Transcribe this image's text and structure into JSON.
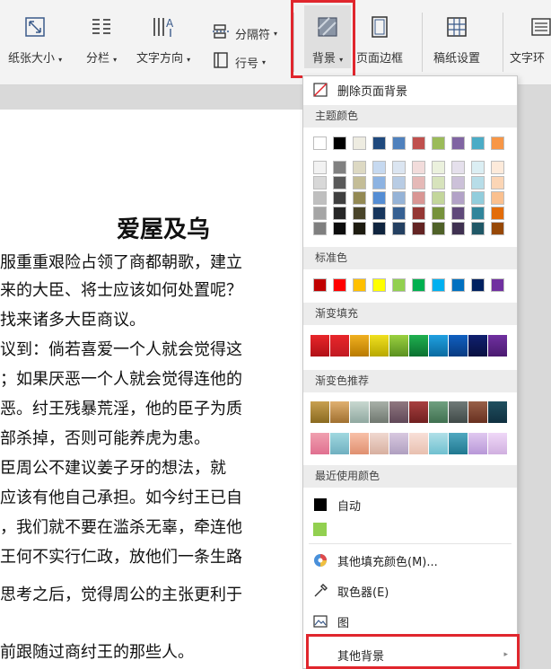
{
  "toolbar": {
    "paper_size": "纸张大小",
    "columns": "分栏",
    "text_direction": "文字方向",
    "breaks": "分隔符",
    "line_numbers": "行号",
    "background": "背景",
    "page_border": "页面边框",
    "manuscript": "稿纸设置",
    "text_wrap": "文字环"
  },
  "document": {
    "title": "爱屋及乌",
    "lines": [
      "服重重艰险占领了商都朝歌，建立",
      "来的大臣、将士应该如何处置呢？",
      "找来诸多大臣商议。",
      "议到：倘若喜爱一个人就会觉得这",
      "；如果厌恶一个人就会觉得连他的",
      "恶。纣王残暴荒淫，他的臣子为质",
      "部杀掉，否则可能养虎为患。",
      "臣周公不建议姜子牙的想法，就",
      "应该有他自己承担。如今纣王已自",
      "，我们就不要在滥杀无辜，牵连他",
      "王何不实行仁政，放他们一条生路",
      "",
      "思考之后，觉得周公的主张更利于",
      "前跟随过商纣王的那些人。"
    ]
  },
  "menu": {
    "remove_bg": "删除页面背景",
    "theme_colors": "主题颜色",
    "standard_colors": "标准色",
    "gradient_fill": "渐变填充",
    "gradient_recommend": "渐变色推荐",
    "recent_colors": "最近使用颜色",
    "auto": "自动",
    "more_fill": "其他填充颜色(M)...",
    "eyedropper": "取色器(E)",
    "picture": "图",
    "other_bg": "其他背景",
    "theme_top": [
      "#ffffff",
      "#000000",
      "#eeece1",
      "#1f497d",
      "#4f81bd",
      "#c0504d",
      "#9bbb59",
      "#8064a2",
      "#4bacc6",
      "#f79646"
    ],
    "theme_shades": [
      [
        "#f2f2f2",
        "#808080",
        "#ddd9c3",
        "#c6d9f0",
        "#dbe5f1",
        "#f2dcdb",
        "#ebf1dd",
        "#e5e0ec",
        "#dbeef3",
        "#fdeada"
      ],
      [
        "#d8d8d8",
        "#595959",
        "#c4bd97",
        "#8db3e2",
        "#b8cce4",
        "#e5b9b7",
        "#d7e3bc",
        "#ccc1d9",
        "#b7dde8",
        "#fbd5b5"
      ],
      [
        "#bfbfbf",
        "#3f3f3f",
        "#938953",
        "#548dd4",
        "#95b3d7",
        "#d99694",
        "#c3d69b",
        "#b2a2c7",
        "#92cddc",
        "#fac08f"
      ],
      [
        "#a5a5a5",
        "#262626",
        "#494429",
        "#17365d",
        "#366092",
        "#953734",
        "#76923c",
        "#5f497a",
        "#31859b",
        "#e36c09"
      ],
      [
        "#7f7f7f",
        "#0c0c0c",
        "#1d1b10",
        "#0f243e",
        "#244061",
        "#632423",
        "#4f6128",
        "#3f3151",
        "#205867",
        "#974806"
      ]
    ],
    "standard": [
      "#c00000",
      "#ff0000",
      "#ffc000",
      "#ffff00",
      "#92d050",
      "#00b050",
      "#00b0f0",
      "#0070c0",
      "#002060",
      "#7030a0"
    ],
    "gradient": [
      [
        "#e8262a",
        "#b01016"
      ],
      [
        "#e8262a",
        "#c01a22"
      ],
      [
        "#f0b020",
        "#b87a00"
      ],
      [
        "#f0e020",
        "#b8a800"
      ],
      [
        "#9ad040",
        "#5a9020"
      ],
      [
        "#20b050",
        "#0a7030"
      ],
      [
        "#20a0e0",
        "#0a6aa0"
      ],
      [
        "#1060c0",
        "#083a80"
      ],
      [
        "#102070",
        "#081040"
      ],
      [
        "#7030a0",
        "#4a1a70"
      ]
    ],
    "recommend_row1": [
      [
        "#c8a050",
        "#8a6a20"
      ],
      [
        "#e0b070",
        "#a07030"
      ],
      [
        "#c8d8d0",
        "#90a8a0"
      ],
      [
        "#a8b0a8",
        "#707870"
      ],
      [
        "#907880",
        "#604858"
      ],
      [
        "#a84040",
        "#702020"
      ],
      [
        "#70a080",
        "#407050"
      ],
      [
        "#707a78",
        "#404a48"
      ],
      [
        "#986048",
        "#683020"
      ],
      [
        "#205060",
        "#103040"
      ]
    ],
    "recommend_row2": [
      [
        "#f0a0b0",
        "#e07090"
      ],
      [
        "#a0d8e0",
        "#70b0c0"
      ],
      [
        "#f8c0a8",
        "#e09070"
      ],
      [
        "#f0d8d0",
        "#d8b0a0"
      ],
      [
        "#d8c8e0",
        "#b0a0c0"
      ],
      [
        "#f8e0d8",
        "#e8c0b0"
      ],
      [
        "#b0e0e8",
        "#70c0d0"
      ],
      [
        "#50a8c0",
        "#207890"
      ],
      [
        "#e0c8f0",
        "#b898d8"
      ],
      [
        "#f0d8f8",
        "#d0b0e0"
      ]
    ],
    "recent": [
      "#000000",
      "#92d050"
    ]
  }
}
